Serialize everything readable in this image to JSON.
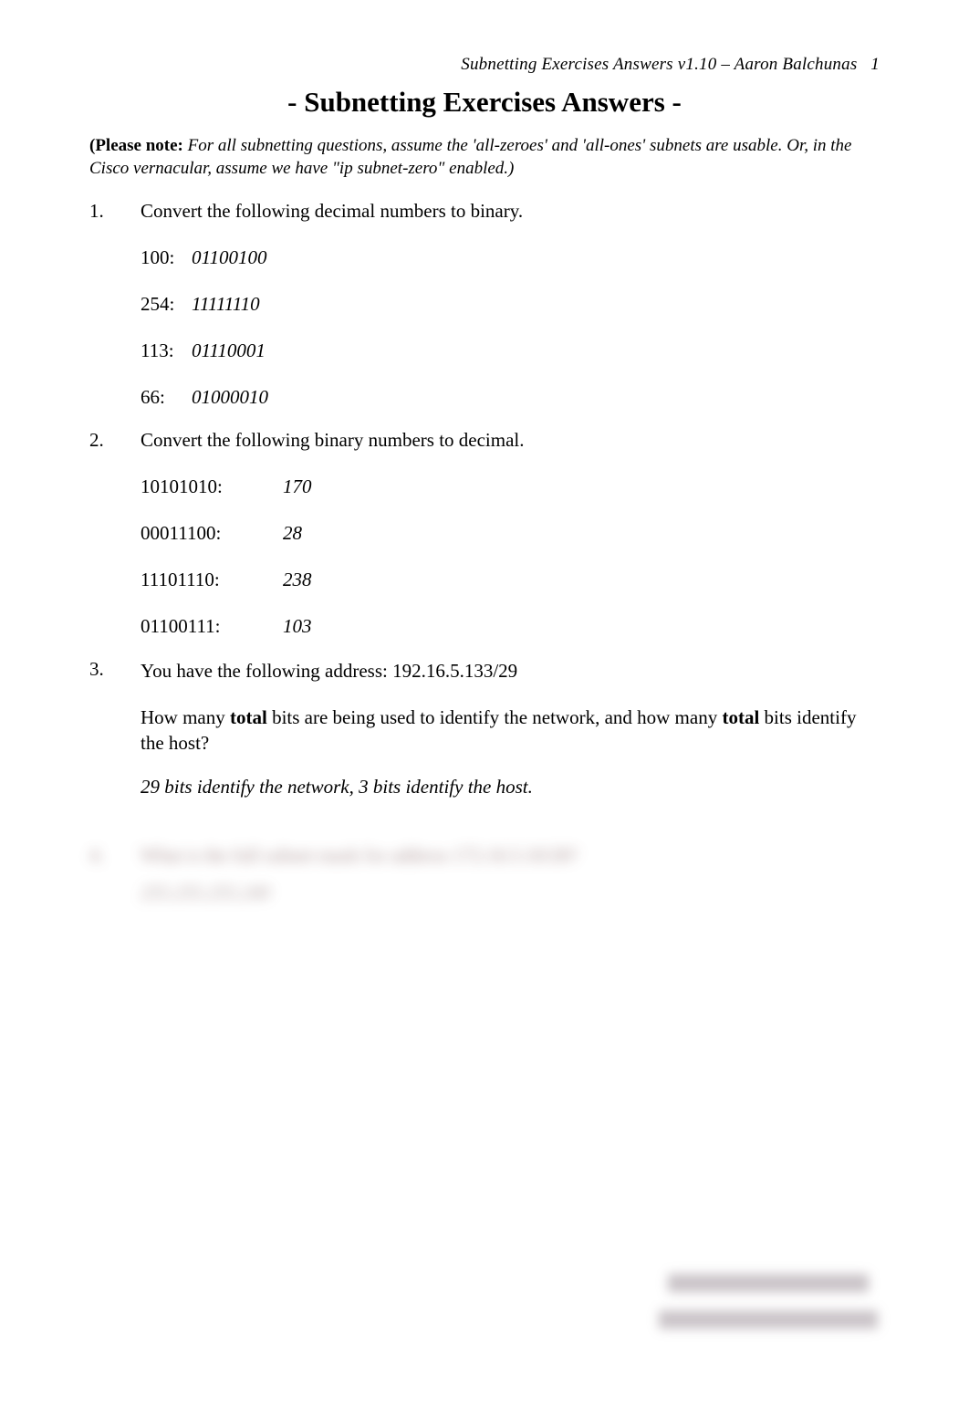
{
  "header": {
    "running_title": "Subnetting Exercises Answers v1.10 – Aaron Balchunas",
    "page_number": "1"
  },
  "title": "- Subnetting Exercises Answers -",
  "note": {
    "prefix_bold": "(Please note:",
    "italic_text": " For all subnetting questions, assume the 'all-zeroes' and 'all-ones' subnets are usable. Or, in the Cisco vernacular, assume we have \"ip subnet-zero\" enabled.)"
  },
  "q1": {
    "number": "1.",
    "prompt": "Convert the following decimal numbers to binary.",
    "rows": [
      {
        "label": "100:",
        "answer": "01100100"
      },
      {
        "label": "254:",
        "answer": "11111110"
      },
      {
        "label": "113:",
        "answer": "01110001"
      },
      {
        "label": "66:",
        "answer": "01000010"
      }
    ]
  },
  "q2": {
    "number": "2.",
    "prompt": "Convert the following binary numbers to decimal.",
    "rows": [
      {
        "label": "10101010:",
        "answer": "170"
      },
      {
        "label": "00011100:",
        "answer": "28"
      },
      {
        "label": "11101110:",
        "answer": "238"
      },
      {
        "label": "01100111:",
        "answer": "103"
      }
    ]
  },
  "q3": {
    "number": "3.",
    "line1": "You have the following address: 192.16.5.133/29",
    "line2_a": "How many ",
    "line2_bold1": "total",
    "line2_b": " bits are being used to identify the network, and how many ",
    "line2_bold2": "total",
    "line2_c": " bits identify the host?",
    "answer": "29 bits identify the network, 3 bits identify the host."
  },
  "q4": {
    "number": "4.",
    "blurred_prompt": "What is the full subnet mask for address 172.16.5.10/28?",
    "blurred_answer": "255.255.255.240"
  }
}
